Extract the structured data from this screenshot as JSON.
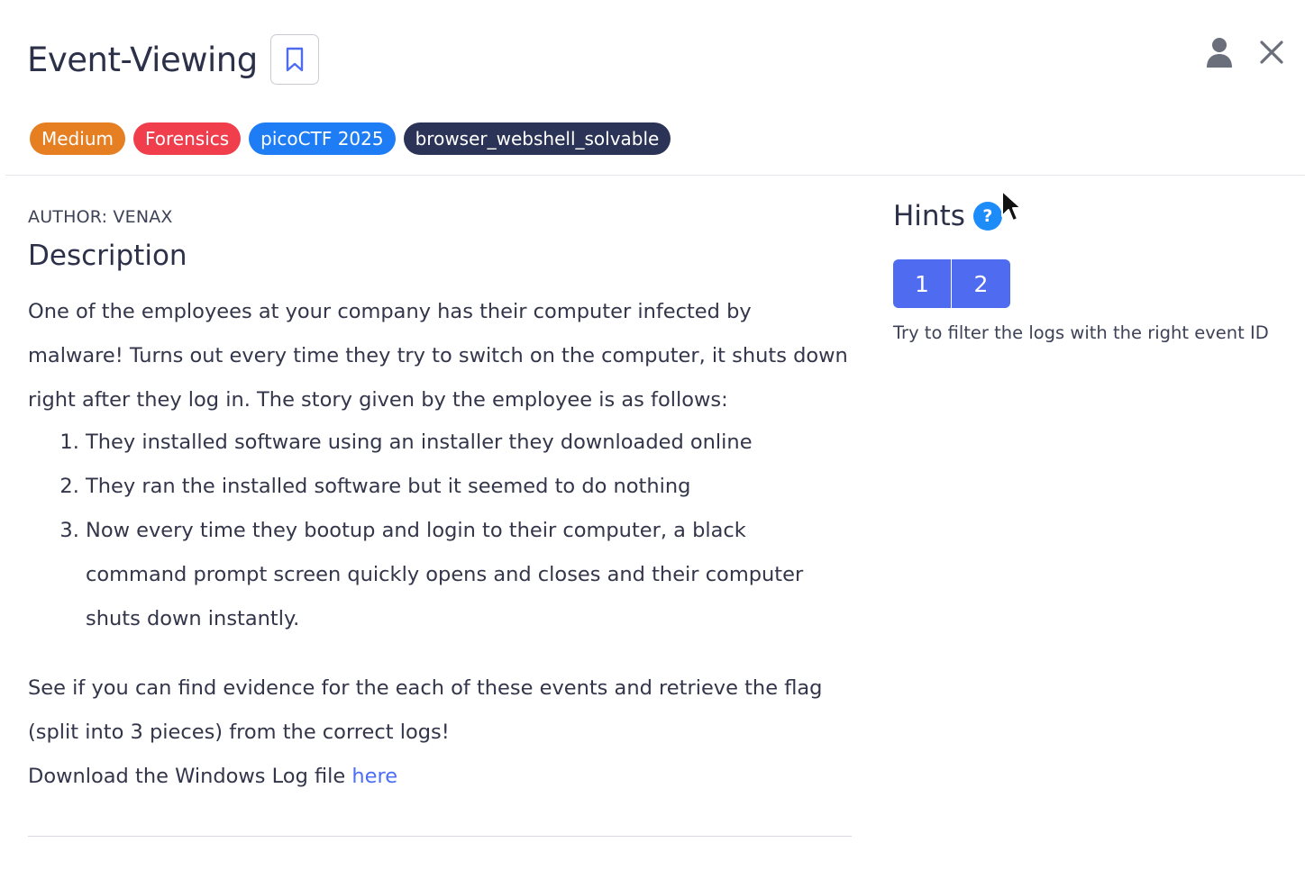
{
  "header": {
    "title": "Event-Viewing"
  },
  "tags": [
    {
      "label": "Medium",
      "color": "#e67e22"
    },
    {
      "label": "Forensics",
      "color": "#f03e4d"
    },
    {
      "label": "picoCTF 2025",
      "color": "#1e7df5"
    },
    {
      "label": "browser_webshell_solvable",
      "color": "#2b3356"
    }
  ],
  "main": {
    "author": "AUTHOR: VENAX",
    "description_heading": "Description",
    "intro": "One of the employees at your company has their computer infected by malware! Turns out every time they try to switch on the computer, it shuts down right after they log in. The story given by the employee is as follows:",
    "steps": [
      "They installed software using an installer they downloaded online",
      "They ran the installed software but it seemed to do nothing",
      "Now every time they bootup and login to their computer, a black command prompt screen quickly opens and closes and their computer shuts down instantly."
    ],
    "closing": "See if you can find evidence for the each of these events and retrieve the flag (split into 3 pieces) from the correct logs!",
    "download_prefix": "Download the Windows Log file ",
    "download_link": "here"
  },
  "hints": {
    "heading": "Hints",
    "help_glyph": "?",
    "buttons": [
      "1",
      "2"
    ],
    "active_hint_text": "Try to filter the logs with the right event ID"
  },
  "icons": {
    "bookmark": "bookmark-icon",
    "user": "user-icon",
    "close": "close-icon",
    "help": "help-icon",
    "cursor": "mouse-cursor-icon"
  },
  "colors": {
    "accent": "#4f6bf0",
    "link": "#4c6ef5",
    "help": "#1d8cf8"
  }
}
